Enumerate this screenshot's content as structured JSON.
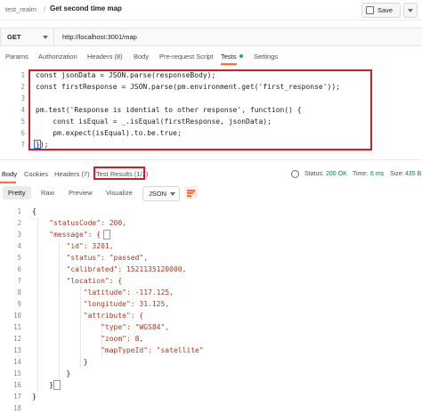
{
  "header": {
    "breadcrumb_collection": "test_realm",
    "breadcrumb_separator": "/",
    "request_title": "Get second time map",
    "save_label": "Save"
  },
  "request": {
    "method": "GET",
    "url": "http://localhost:3001/map"
  },
  "request_tabs": [
    {
      "label": "Params"
    },
    {
      "label": "Authorization"
    },
    {
      "label": "Headers (8)"
    },
    {
      "label": "Body"
    },
    {
      "label": "Pre-request Script"
    },
    {
      "label": "Tests"
    },
    {
      "label": "Settings"
    }
  ],
  "editor": {
    "line_numbers": [
      "1",
      "2",
      "3",
      "4",
      "5",
      "6",
      "7"
    ],
    "lines": [
      "const jsonData = JSON.parse(responseBody);",
      "const firstResponse = JSON.parse(pm.environment.get('first_response'));",
      "",
      "pm.test('Response is idential to other response', function() {",
      "    const isEqual = _.isEqual(firstResponse, jsonData);",
      "    pm.expect(isEqual).to.be.true;",
      "});"
    ]
  },
  "response_tabs": [
    {
      "label": "Body"
    },
    {
      "label": "Cookies"
    },
    {
      "label": "Headers (7)"
    },
    {
      "label": "Test Results (1/1)"
    }
  ],
  "response_status": {
    "status_label": "Status:",
    "status_value": "200 OK",
    "time_label": "Time:",
    "time_value": "6 ms",
    "size_label": "Size:",
    "size_value": "435 B"
  },
  "view_modes": [
    {
      "label": "Pretty"
    },
    {
      "label": "Raw"
    },
    {
      "label": "Preview"
    },
    {
      "label": "Visualize"
    }
  ],
  "format_select": "JSON",
  "response_body": {
    "line_numbers": [
      "1",
      "2",
      "3",
      "4",
      "5",
      "6",
      "7",
      "8",
      "9",
      "10",
      "11",
      "12",
      "13",
      "14",
      "15",
      "16",
      "17",
      "18"
    ],
    "lines": [
      "{",
      "    \"statusCode\": 200,",
      "    \"message\": {",
      "        \"id\": 3201,",
      "        \"status\": \"passed\",",
      "        \"calibrated\": 1521135120000,",
      "        \"location\": {",
      "            \"latitude\": -117.125,",
      "            \"longitude\": 31.125,",
      "            \"attribute\": {",
      "                \"type\": \"WGS84\",",
      "                \"zoom\": 8,",
      "                \"mapTypeId\": \"satellite\"",
      "            }",
      "        }",
      "    }",
      "}",
      ""
    ]
  },
  "colors": {
    "accent": "#ff6c37",
    "highlight_border": "#cc1f2c",
    "status_ok": "#0cbb52",
    "json_key": "#a5381f",
    "json_string": "#0b7a4b",
    "json_number": "#0b42b4"
  },
  "icons": [
    "save-icon",
    "chevron-down-icon",
    "dropdown-caret-icon",
    "green-dot-icon",
    "globe-icon",
    "more-icon",
    "wrap-lines-icon"
  ]
}
